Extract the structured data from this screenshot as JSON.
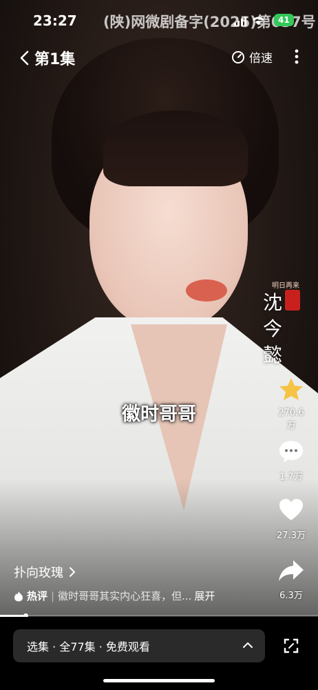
{
  "status_bar": {
    "time": "23:27",
    "license": "(陕)网微剧备字(2025)第037号",
    "battery": "41"
  },
  "top_bar": {
    "episode": "第1集",
    "speed_label": "倍速"
  },
  "promo": {
    "label": "明日再来"
  },
  "overlay_title": [
    "沈",
    "今",
    "懿"
  ],
  "subtitle": "徽时哥哥",
  "actions": {
    "collect_count": "270.6万",
    "comment_count": "1.7万",
    "like_count": "27.3万",
    "share_count": "6.3万"
  },
  "author": "扑向玫瑰",
  "hot_comment": {
    "tag": "热评",
    "text": "徽时哥哥其实内心狂喜，但...",
    "expand": "展开"
  },
  "progress": 0.08,
  "episode_bar": {
    "text": "选集 · 全77集 · 免费观看"
  },
  "colors": {
    "battery": "#34c759",
    "star": "#f6c344",
    "episode_bar_bg": "#2a2a2a"
  },
  "icons": [
    "back-chevron-icon",
    "speed-icon",
    "more-icon",
    "star-icon",
    "comment-icon",
    "heart-icon",
    "share-icon",
    "flame-icon",
    "chevron-right-icon",
    "chevron-up-icon",
    "fullscreen-icon"
  ]
}
